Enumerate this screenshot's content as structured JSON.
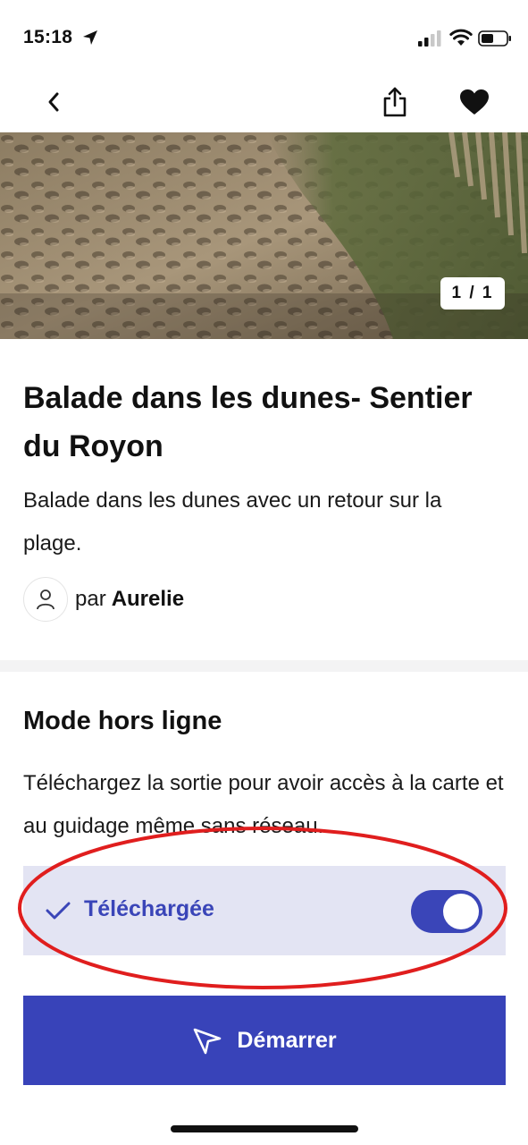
{
  "status_bar": {
    "time": "15:18",
    "icons": [
      "location-arrow-icon",
      "signal-icon",
      "wifi-icon",
      "battery-icon"
    ]
  },
  "nav": {
    "icons": [
      "chevron-left-icon",
      "share-icon",
      "heart-icon"
    ]
  },
  "hero": {
    "counter": "1 / 1"
  },
  "walk": {
    "title": "Balade dans les dunes- Sentier du Royon",
    "description": "Balade dans les dunes avec un retour sur la plage.",
    "author_prefix": "par",
    "author_name": "Aurelie"
  },
  "offline": {
    "title": "Mode hors ligne",
    "description": "Téléchargez la sortie pour avoir accès à la carte et au guidage même sans réseau.",
    "downloaded_label": "Téléchargée",
    "toggle_on": true
  },
  "start_button": {
    "label": "Démarrer"
  },
  "colors": {
    "accent": "#3843b9",
    "accent_light": "#e3e4f3",
    "annotation": "#e01e1e"
  }
}
